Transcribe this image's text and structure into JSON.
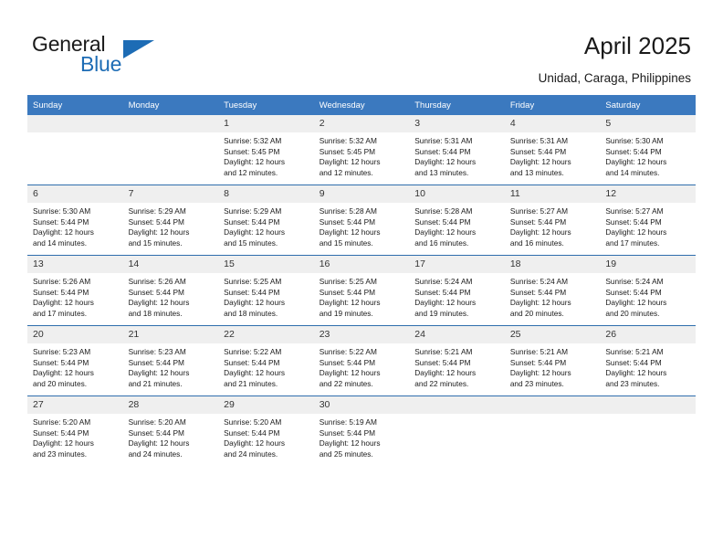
{
  "logo": {
    "word_one": "General",
    "word_two": "Blue",
    "flag_icon": "triangle-flag-icon",
    "accent_color": "#1d6cb5"
  },
  "header": {
    "title": "April 2025",
    "location": "Unidad, Caraga, Philippines"
  },
  "theme": {
    "header_row_color": "#3b79bf",
    "week_separator_color": "#2f6ead",
    "daynum_band_color": "#efefef",
    "text_color": "#1a1a1a"
  },
  "weekdays": [
    "Sunday",
    "Monday",
    "Tuesday",
    "Wednesday",
    "Thursday",
    "Friday",
    "Saturday"
  ],
  "labels": {
    "sunrise_prefix": "Sunrise:",
    "sunset_prefix": "Sunset:",
    "daylight_prefix": "Daylight:"
  },
  "weeks": [
    [
      {
        "day": "",
        "blank": true,
        "sunrise": "",
        "sunset": "",
        "daylight_line1": "",
        "daylight_line2": ""
      },
      {
        "day": "",
        "blank": true,
        "sunrise": "",
        "sunset": "",
        "daylight_line1": "",
        "daylight_line2": ""
      },
      {
        "day": "1",
        "blank": false,
        "sunrise": "Sunrise: 5:32 AM",
        "sunset": "Sunset: 5:45 PM",
        "daylight_line1": "Daylight: 12 hours",
        "daylight_line2": "and 12 minutes."
      },
      {
        "day": "2",
        "blank": false,
        "sunrise": "Sunrise: 5:32 AM",
        "sunset": "Sunset: 5:45 PM",
        "daylight_line1": "Daylight: 12 hours",
        "daylight_line2": "and 12 minutes."
      },
      {
        "day": "3",
        "blank": false,
        "sunrise": "Sunrise: 5:31 AM",
        "sunset": "Sunset: 5:44 PM",
        "daylight_line1": "Daylight: 12 hours",
        "daylight_line2": "and 13 minutes."
      },
      {
        "day": "4",
        "blank": false,
        "sunrise": "Sunrise: 5:31 AM",
        "sunset": "Sunset: 5:44 PM",
        "daylight_line1": "Daylight: 12 hours",
        "daylight_line2": "and 13 minutes."
      },
      {
        "day": "5",
        "blank": false,
        "sunrise": "Sunrise: 5:30 AM",
        "sunset": "Sunset: 5:44 PM",
        "daylight_line1": "Daylight: 12 hours",
        "daylight_line2": "and 14 minutes."
      }
    ],
    [
      {
        "day": "6",
        "blank": false,
        "sunrise": "Sunrise: 5:30 AM",
        "sunset": "Sunset: 5:44 PM",
        "daylight_line1": "Daylight: 12 hours",
        "daylight_line2": "and 14 minutes."
      },
      {
        "day": "7",
        "blank": false,
        "sunrise": "Sunrise: 5:29 AM",
        "sunset": "Sunset: 5:44 PM",
        "daylight_line1": "Daylight: 12 hours",
        "daylight_line2": "and 15 minutes."
      },
      {
        "day": "8",
        "blank": false,
        "sunrise": "Sunrise: 5:29 AM",
        "sunset": "Sunset: 5:44 PM",
        "daylight_line1": "Daylight: 12 hours",
        "daylight_line2": "and 15 minutes."
      },
      {
        "day": "9",
        "blank": false,
        "sunrise": "Sunrise: 5:28 AM",
        "sunset": "Sunset: 5:44 PM",
        "daylight_line1": "Daylight: 12 hours",
        "daylight_line2": "and 15 minutes."
      },
      {
        "day": "10",
        "blank": false,
        "sunrise": "Sunrise: 5:28 AM",
        "sunset": "Sunset: 5:44 PM",
        "daylight_line1": "Daylight: 12 hours",
        "daylight_line2": "and 16 minutes."
      },
      {
        "day": "11",
        "blank": false,
        "sunrise": "Sunrise: 5:27 AM",
        "sunset": "Sunset: 5:44 PM",
        "daylight_line1": "Daylight: 12 hours",
        "daylight_line2": "and 16 minutes."
      },
      {
        "day": "12",
        "blank": false,
        "sunrise": "Sunrise: 5:27 AM",
        "sunset": "Sunset: 5:44 PM",
        "daylight_line1": "Daylight: 12 hours",
        "daylight_line2": "and 17 minutes."
      }
    ],
    [
      {
        "day": "13",
        "blank": false,
        "sunrise": "Sunrise: 5:26 AM",
        "sunset": "Sunset: 5:44 PM",
        "daylight_line1": "Daylight: 12 hours",
        "daylight_line2": "and 17 minutes."
      },
      {
        "day": "14",
        "blank": false,
        "sunrise": "Sunrise: 5:26 AM",
        "sunset": "Sunset: 5:44 PM",
        "daylight_line1": "Daylight: 12 hours",
        "daylight_line2": "and 18 minutes."
      },
      {
        "day": "15",
        "blank": false,
        "sunrise": "Sunrise: 5:25 AM",
        "sunset": "Sunset: 5:44 PM",
        "daylight_line1": "Daylight: 12 hours",
        "daylight_line2": "and 18 minutes."
      },
      {
        "day": "16",
        "blank": false,
        "sunrise": "Sunrise: 5:25 AM",
        "sunset": "Sunset: 5:44 PM",
        "daylight_line1": "Daylight: 12 hours",
        "daylight_line2": "and 19 minutes."
      },
      {
        "day": "17",
        "blank": false,
        "sunrise": "Sunrise: 5:24 AM",
        "sunset": "Sunset: 5:44 PM",
        "daylight_line1": "Daylight: 12 hours",
        "daylight_line2": "and 19 minutes."
      },
      {
        "day": "18",
        "blank": false,
        "sunrise": "Sunrise: 5:24 AM",
        "sunset": "Sunset: 5:44 PM",
        "daylight_line1": "Daylight: 12 hours",
        "daylight_line2": "and 20 minutes."
      },
      {
        "day": "19",
        "blank": false,
        "sunrise": "Sunrise: 5:24 AM",
        "sunset": "Sunset: 5:44 PM",
        "daylight_line1": "Daylight: 12 hours",
        "daylight_line2": "and 20 minutes."
      }
    ],
    [
      {
        "day": "20",
        "blank": false,
        "sunrise": "Sunrise: 5:23 AM",
        "sunset": "Sunset: 5:44 PM",
        "daylight_line1": "Daylight: 12 hours",
        "daylight_line2": "and 20 minutes."
      },
      {
        "day": "21",
        "blank": false,
        "sunrise": "Sunrise: 5:23 AM",
        "sunset": "Sunset: 5:44 PM",
        "daylight_line1": "Daylight: 12 hours",
        "daylight_line2": "and 21 minutes."
      },
      {
        "day": "22",
        "blank": false,
        "sunrise": "Sunrise: 5:22 AM",
        "sunset": "Sunset: 5:44 PM",
        "daylight_line1": "Daylight: 12 hours",
        "daylight_line2": "and 21 minutes."
      },
      {
        "day": "23",
        "blank": false,
        "sunrise": "Sunrise: 5:22 AM",
        "sunset": "Sunset: 5:44 PM",
        "daylight_line1": "Daylight: 12 hours",
        "daylight_line2": "and 22 minutes."
      },
      {
        "day": "24",
        "blank": false,
        "sunrise": "Sunrise: 5:21 AM",
        "sunset": "Sunset: 5:44 PM",
        "daylight_line1": "Daylight: 12 hours",
        "daylight_line2": "and 22 minutes."
      },
      {
        "day": "25",
        "blank": false,
        "sunrise": "Sunrise: 5:21 AM",
        "sunset": "Sunset: 5:44 PM",
        "daylight_line1": "Daylight: 12 hours",
        "daylight_line2": "and 23 minutes."
      },
      {
        "day": "26",
        "blank": false,
        "sunrise": "Sunrise: 5:21 AM",
        "sunset": "Sunset: 5:44 PM",
        "daylight_line1": "Daylight: 12 hours",
        "daylight_line2": "and 23 minutes."
      }
    ],
    [
      {
        "day": "27",
        "blank": false,
        "sunrise": "Sunrise: 5:20 AM",
        "sunset": "Sunset: 5:44 PM",
        "daylight_line1": "Daylight: 12 hours",
        "daylight_line2": "and 23 minutes."
      },
      {
        "day": "28",
        "blank": false,
        "sunrise": "Sunrise: 5:20 AM",
        "sunset": "Sunset: 5:44 PM",
        "daylight_line1": "Daylight: 12 hours",
        "daylight_line2": "and 24 minutes."
      },
      {
        "day": "29",
        "blank": false,
        "sunrise": "Sunrise: 5:20 AM",
        "sunset": "Sunset: 5:44 PM",
        "daylight_line1": "Daylight: 12 hours",
        "daylight_line2": "and 24 minutes."
      },
      {
        "day": "30",
        "blank": false,
        "sunrise": "Sunrise: 5:19 AM",
        "sunset": "Sunset: 5:44 PM",
        "daylight_line1": "Daylight: 12 hours",
        "daylight_line2": "and 25 minutes."
      },
      {
        "day": "",
        "blank": true,
        "sunrise": "",
        "sunset": "",
        "daylight_line1": "",
        "daylight_line2": ""
      },
      {
        "day": "",
        "blank": true,
        "sunrise": "",
        "sunset": "",
        "daylight_line1": "",
        "daylight_line2": ""
      },
      {
        "day": "",
        "blank": true,
        "sunrise": "",
        "sunset": "",
        "daylight_line1": "",
        "daylight_line2": ""
      }
    ]
  ]
}
